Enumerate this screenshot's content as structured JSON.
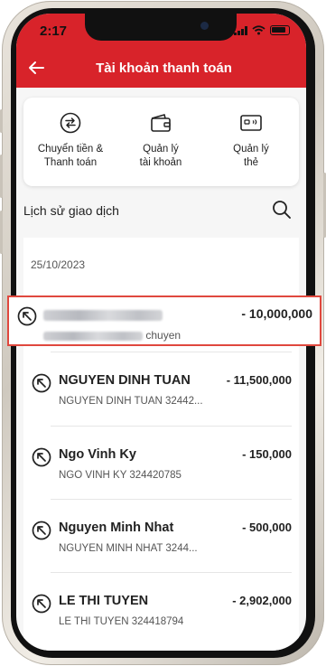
{
  "status_bar": {
    "time": "2:17"
  },
  "header": {
    "title": "Tài khoản thanh toán",
    "back_icon": "arrow-left-icon"
  },
  "quick_actions": [
    {
      "label": "Chuyển tiền &\nThanh toán",
      "icon": "transfer-icon"
    },
    {
      "label": "Quản lý\ntài khoản",
      "icon": "wallet-icon"
    },
    {
      "label": "Quản lý\nthẻ",
      "icon": "card-icon"
    }
  ],
  "history": {
    "title": "Lịch sử giao dịch",
    "search_icon": "search-icon",
    "date": "25/10/2023",
    "highlighted": {
      "desc_suffix": "chuyen",
      "amount": "- 10,000,000"
    },
    "transactions": [
      {
        "name": "NGUYEN DINH TUAN",
        "desc": "NGUYEN DINH TUAN 32442...",
        "amount": "- 11,500,000"
      },
      {
        "name": "Ngo Vinh Ky",
        "desc": "NGO VINH KY 324420785",
        "amount": "- 150,000"
      },
      {
        "name": "Nguyen Minh Nhat",
        "desc": "NGUYEN MINH NHAT 3244...",
        "amount": "- 500,000"
      },
      {
        "name": "LE THI TUYEN",
        "desc": "LE THI TUYEN 324418794",
        "amount": "- 2,902,000"
      }
    ]
  },
  "colors": {
    "brand_red": "#d8232a",
    "highlight_border": "#e0483e"
  }
}
